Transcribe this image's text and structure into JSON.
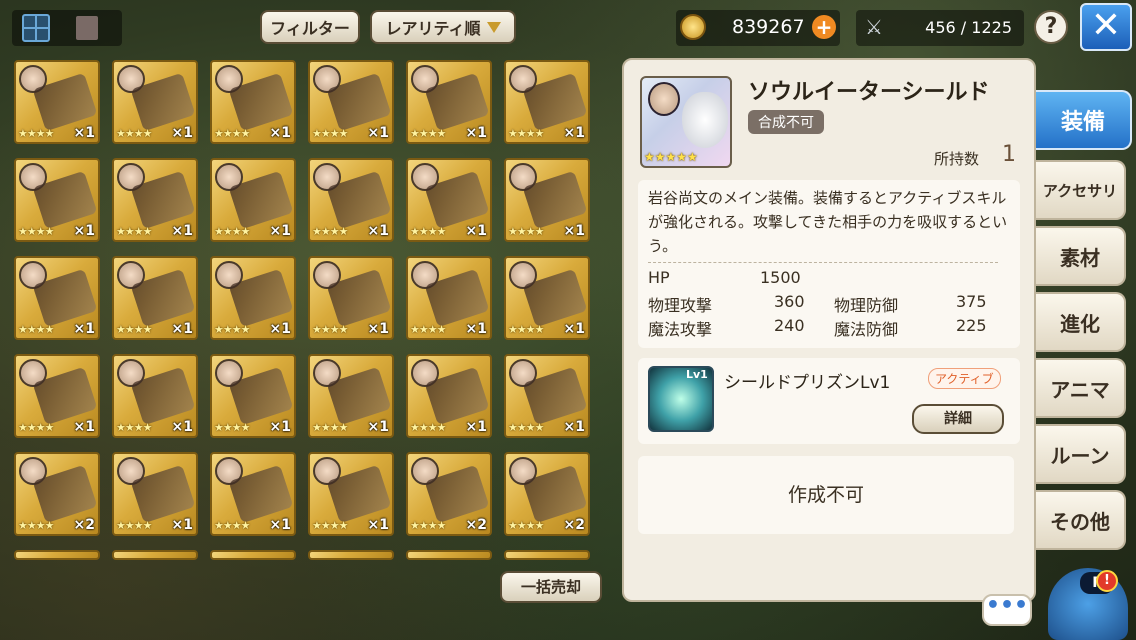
{
  "header": {
    "filter_label": "フィルター",
    "sort_label": "レアリティ順",
    "coins": "839267",
    "plus": "+",
    "capacity": "456 / 1225",
    "help": "?",
    "close": "✕"
  },
  "grid": {
    "items": [
      {
        "stars": "★★★★",
        "qty": "×1"
      },
      {
        "stars": "★★★★",
        "qty": "×1"
      },
      {
        "stars": "★★★★",
        "qty": "×1"
      },
      {
        "stars": "★★★★",
        "qty": "×1"
      },
      {
        "stars": "★★★★",
        "qty": "×1"
      },
      {
        "stars": "★★★★",
        "qty": "×1"
      },
      {
        "stars": "★★★★",
        "qty": "×1"
      },
      {
        "stars": "★★★★",
        "qty": "×1"
      },
      {
        "stars": "★★★★",
        "qty": "×1"
      },
      {
        "stars": "★★★★",
        "qty": "×1"
      },
      {
        "stars": "★★★★",
        "qty": "×1"
      },
      {
        "stars": "★★★★",
        "qty": "×1"
      },
      {
        "stars": "★★★★",
        "qty": "×1"
      },
      {
        "stars": "★★★★",
        "qty": "×1"
      },
      {
        "stars": "★★★★",
        "qty": "×1"
      },
      {
        "stars": "★★★★",
        "qty": "×1"
      },
      {
        "stars": "★★★★",
        "qty": "×1"
      },
      {
        "stars": "★★★★",
        "qty": "×1"
      },
      {
        "stars": "★★★★",
        "qty": "×1"
      },
      {
        "stars": "★★★★",
        "qty": "×1"
      },
      {
        "stars": "★★★★",
        "qty": "×1"
      },
      {
        "stars": "★★★★",
        "qty": "×1"
      },
      {
        "stars": "★★★★",
        "qty": "×1"
      },
      {
        "stars": "★★★★",
        "qty": "×1"
      },
      {
        "stars": "★★★★",
        "qty": "×2"
      },
      {
        "stars": "★★★★",
        "qty": "×1"
      },
      {
        "stars": "★★★★",
        "qty": "×1"
      },
      {
        "stars": "★★★★",
        "qty": "×1"
      },
      {
        "stars": "★★★★",
        "qty": "×2"
      },
      {
        "stars": "★★★★",
        "qty": "×2"
      }
    ],
    "sell_all": "一括売却"
  },
  "detail": {
    "name": "ソウルイーターシールド",
    "badge": "合成不可",
    "thumb_stars": "★★★★★",
    "owned_label": "所持数",
    "owned_count": "1",
    "description": "岩谷尚文のメイン装備。装備するとアクティブスキルが強化される。攻撃してきた相手の力を吸収するという。",
    "stats": {
      "hp_label": "HP",
      "hp": "1500",
      "patk_label": "物理攻撃",
      "patk": "360",
      "pdef_label": "物理防御",
      "pdef": "375",
      "matk_label": "魔法攻撃",
      "matk": "240",
      "mdef_label": "魔法防御",
      "mdef": "225"
    },
    "skill": {
      "name": "シールドプリズンLv1",
      "tag": "アクティブ",
      "level_badge": "Lv1",
      "detail_label": "詳細"
    },
    "create_status": "作成不可"
  },
  "tabs": [
    {
      "label": "装備"
    },
    {
      "label": "アクセサリ"
    },
    {
      "label": "素材"
    },
    {
      "label": "進化"
    },
    {
      "label": "アニマ"
    },
    {
      "label": "ルーン"
    },
    {
      "label": "その他"
    }
  ],
  "chat": "•••",
  "mascot_text": "F"
}
